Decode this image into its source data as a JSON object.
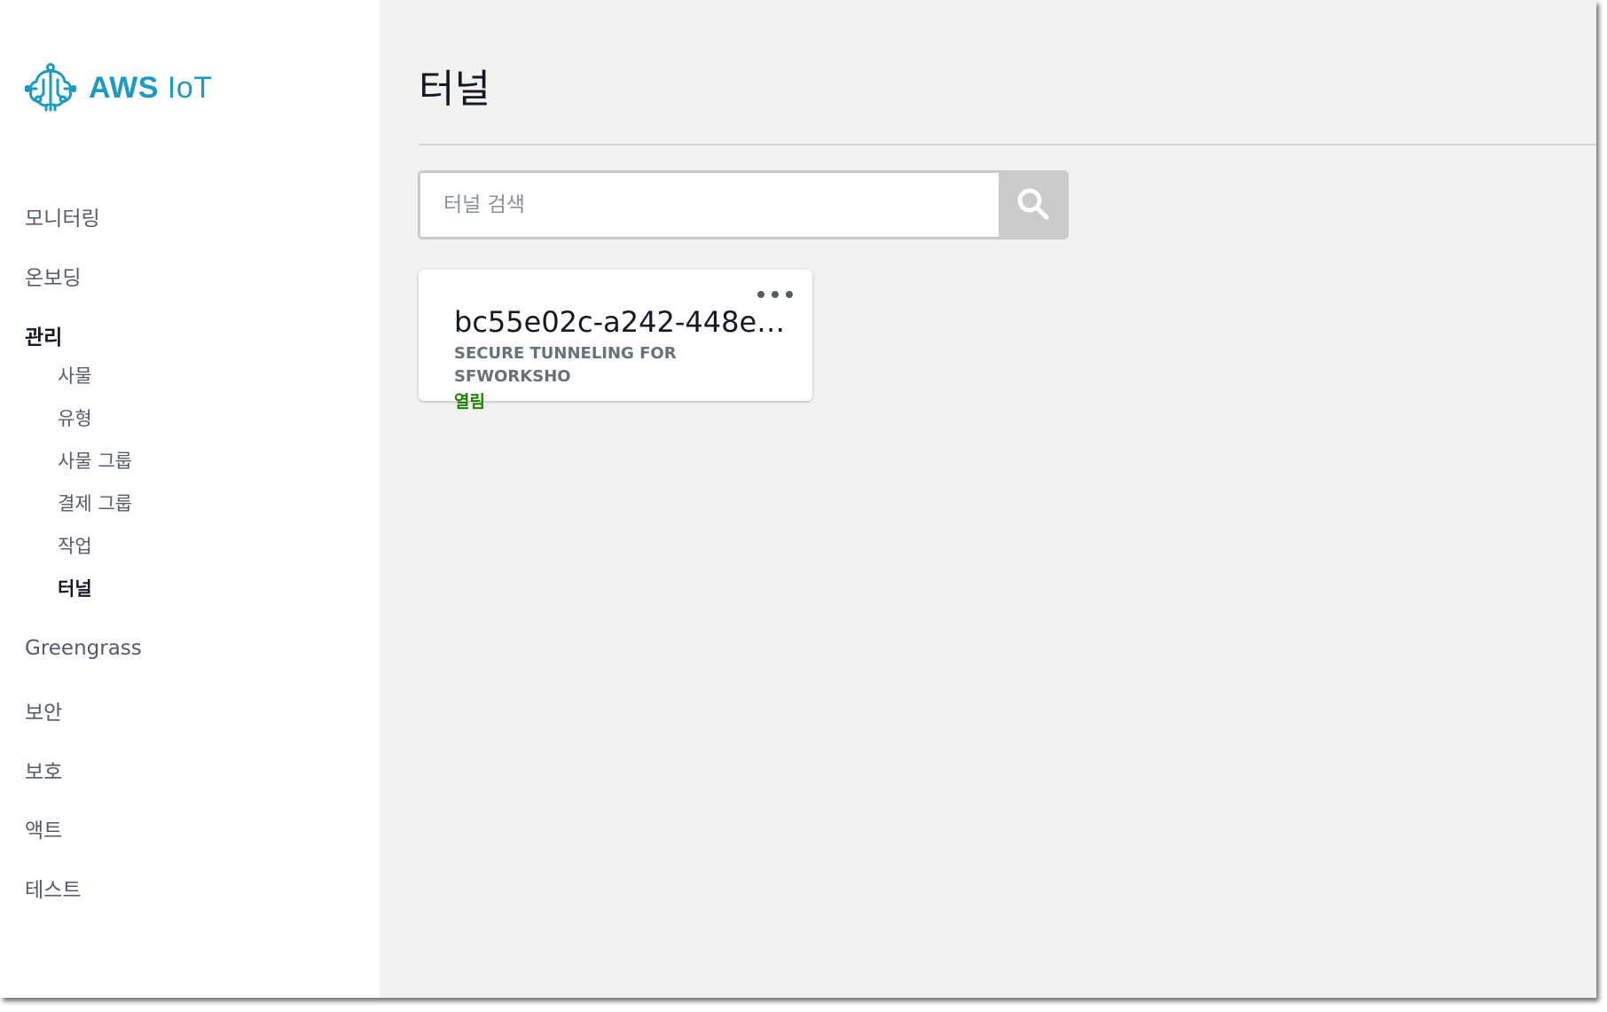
{
  "brand": {
    "name_prefix": "AWS",
    "name_suffix": "IoT",
    "color": "#1b9ac4",
    "icon": "aws-iot-brain-icon"
  },
  "sidebar": {
    "items": [
      {
        "label": "모니터링"
      },
      {
        "label": "온보딩"
      },
      {
        "label": "관리"
      },
      {
        "label": "Greengrass"
      },
      {
        "label": "보안"
      },
      {
        "label": "보호"
      },
      {
        "label": "액트"
      },
      {
        "label": "테스트"
      }
    ],
    "manage_subitems": [
      {
        "label": "사물"
      },
      {
        "label": "유형"
      },
      {
        "label": "사물 그룹"
      },
      {
        "label": "결제 그룹"
      },
      {
        "label": "작업"
      },
      {
        "label": "터널",
        "active": true
      }
    ]
  },
  "main": {
    "title": "터널",
    "search": {
      "placeholder": "터널 검색",
      "value": "",
      "button_icon": "search-icon"
    },
    "tunnels": [
      {
        "id": "bc55e02c-a242-448e-…",
        "description": "SECURE TUNNELING FOR SFWORKSHO",
        "status": "열림",
        "menu_icon": "ellipsis-icon"
      }
    ]
  },
  "colors": {
    "status_open": "#1d8102",
    "content_background": "#f2f2f2",
    "search_button": "#cbcbcb"
  }
}
